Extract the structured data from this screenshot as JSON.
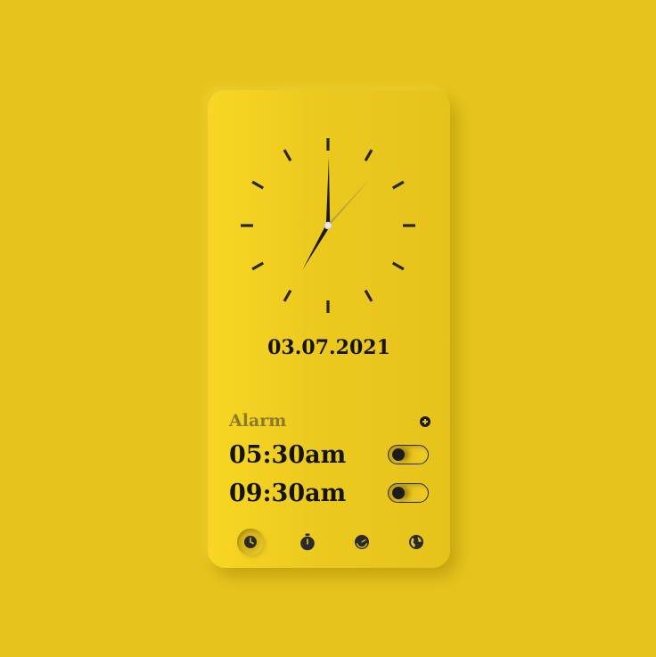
{
  "clock": {
    "hour": 7,
    "minute": 0,
    "second": 7
  },
  "date": "03.07.2021",
  "alarm": {
    "title": "Alarm",
    "items": [
      {
        "time": "05:30am",
        "enabled": false
      },
      {
        "time": "09:30am",
        "enabled": false
      }
    ]
  },
  "nav": {
    "items": [
      {
        "icon": "clock-icon",
        "active": true
      },
      {
        "icon": "stopwatch-icon",
        "active": false
      },
      {
        "icon": "timer-icon",
        "active": false
      },
      {
        "icon": "globe-icon",
        "active": false
      }
    ]
  },
  "colors": {
    "background": "#e7c41d",
    "ink": "#141414",
    "muted": "#8a7a2c"
  }
}
